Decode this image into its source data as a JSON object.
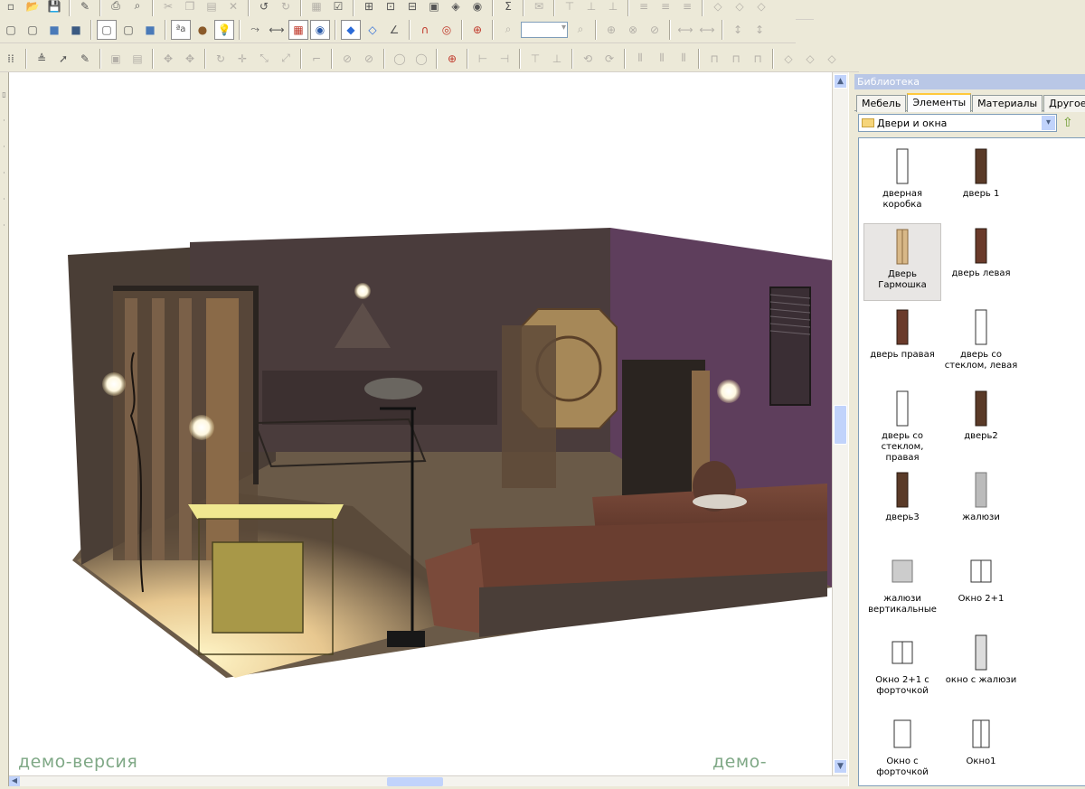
{
  "viewport": {
    "watermark_left": "демо-версия",
    "watermark_right": "демо-версия"
  },
  "library": {
    "title": "Библиотека",
    "tabs": [
      "Мебель",
      "Элементы",
      "Материалы",
      "Другое"
    ],
    "active_tab": "Элементы",
    "category": "Двери и окна",
    "items": [
      "дверная коробка",
      "дверь 1",
      "Дверь Гармошка",
      "дверь левая",
      "дверь правая",
      "дверь со стеклом, левая",
      "дверь со стеклом, правая",
      "дверь2",
      "дверь3",
      "жалюзи",
      "жалюзи вертикальные",
      "Окно 2+1",
      "Окно 2+1 с форточкой",
      "окно с жалюзи",
      "Окно с форточкой",
      "Окно1"
    ],
    "selected_item": "Дверь Гармошка"
  }
}
